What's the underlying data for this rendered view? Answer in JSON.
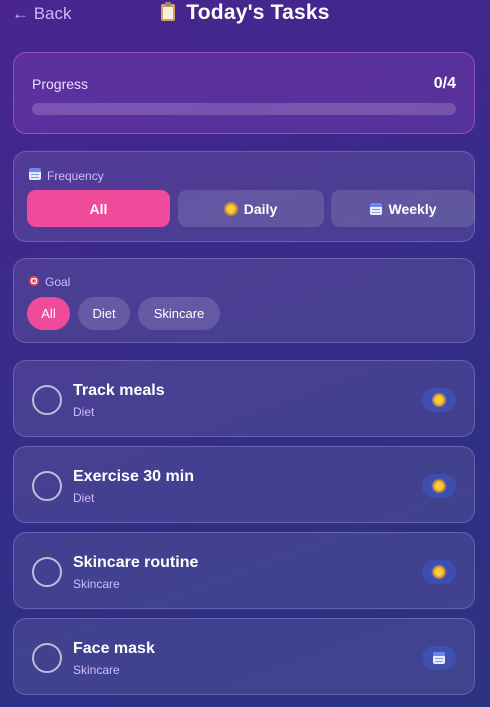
{
  "header": {
    "back_label": "← Back",
    "title": "Today's Tasks",
    "title_icon": "clipboard-icon"
  },
  "progress": {
    "label": "Progress",
    "count": "0/4",
    "completed": 0,
    "total": 4,
    "accent": "#ee4c9b"
  },
  "frequency": {
    "label": "Frequency",
    "icon": "calendar-icon",
    "options": [
      {
        "label": "All",
        "icon": null,
        "active": true
      },
      {
        "label": "Daily",
        "icon": "sun-icon",
        "active": false
      },
      {
        "label": "Weekly",
        "icon": "calendar-icon",
        "active": false
      }
    ]
  },
  "goal": {
    "label": "Goal",
    "icon": "target-icon",
    "options": [
      {
        "label": "All",
        "active": true
      },
      {
        "label": "Diet",
        "active": false
      },
      {
        "label": "Skincare",
        "active": false
      }
    ]
  },
  "tasks": [
    {
      "name": "Track meals",
      "category": "Diet",
      "frequency_icon": "sun-icon",
      "done": false
    },
    {
      "name": "Exercise 30 min",
      "category": "Diet",
      "frequency_icon": "sun-icon",
      "done": false
    },
    {
      "name": "Skincare routine",
      "category": "Skincare",
      "frequency_icon": "sun-icon",
      "done": false
    },
    {
      "name": "Face mask",
      "category": "Skincare",
      "frequency_icon": "calendar-icon",
      "done": false
    }
  ]
}
